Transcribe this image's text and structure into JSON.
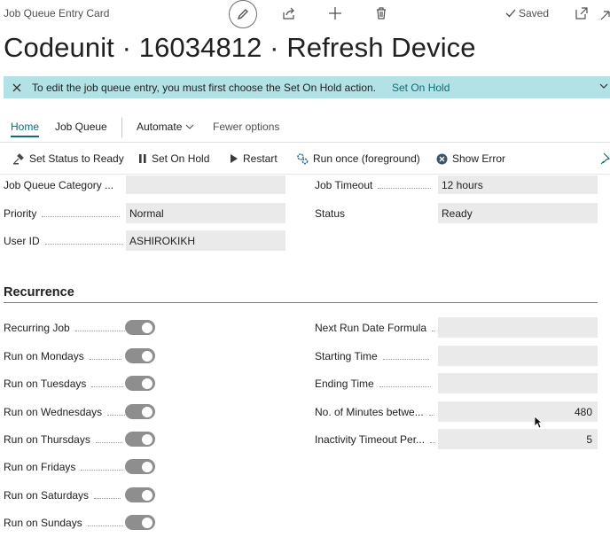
{
  "window": {
    "title": "Job Queue Entry Card",
    "saved_label": "Saved"
  },
  "page": {
    "title": "Codeunit · 16034812 · Refresh Device"
  },
  "banner": {
    "message": "To edit the job queue entry, you must first choose the Set On Hold action.",
    "action": "Set On Hold"
  },
  "tabs": [
    {
      "label": "Home",
      "active": true
    },
    {
      "label": "Job Queue"
    },
    {
      "label": "Automate"
    },
    {
      "label": "Fewer options"
    }
  ],
  "actions": [
    {
      "label": "Set Status to Ready",
      "icon": "set-status-icon"
    },
    {
      "label": "Set On Hold",
      "icon": "pause-icon"
    },
    {
      "label": "Restart",
      "icon": "play-icon"
    },
    {
      "label": "Run once (foreground)",
      "icon": "run-gears-icon"
    },
    {
      "label": "Show Error",
      "icon": "error-icon"
    }
  ],
  "general": {
    "category": {
      "label": "Job Queue Category ...",
      "value": ""
    },
    "priority": {
      "label": "Priority",
      "value": "Normal"
    },
    "user_id": {
      "label": "User ID",
      "value": "ASHIROKIKH"
    },
    "timeout": {
      "label": "Job Timeout",
      "value": "12 hours"
    },
    "status": {
      "label": "Status",
      "value": "Ready"
    }
  },
  "recurrence": {
    "title": "Recurrence",
    "toggles": [
      {
        "label": "Recurring Job",
        "on": true
      },
      {
        "label": "Run on Mondays",
        "on": true
      },
      {
        "label": "Run on Tuesdays",
        "on": true
      },
      {
        "label": "Run on Wednesdays",
        "on": true
      },
      {
        "label": "Run on Thursdays",
        "on": true
      },
      {
        "label": "Run on Fridays",
        "on": true
      },
      {
        "label": "Run on Saturdays",
        "on": true
      },
      {
        "label": "Run on Sundays",
        "on": true
      }
    ],
    "fields": [
      {
        "label": "Next Run Date Formula",
        "value": ""
      },
      {
        "label": "Starting Time",
        "value": ""
      },
      {
        "label": "Ending Time",
        "value": ""
      },
      {
        "label": "No. of Minutes betwe...",
        "value": "480"
      },
      {
        "label": "Inactivity Timeout Per...",
        "value": "5"
      }
    ]
  },
  "colors": {
    "accent": "#0f6b74",
    "banner": "#b2e1e6",
    "field": "#eaeaea",
    "toggle_on": "#8e8e8e"
  }
}
